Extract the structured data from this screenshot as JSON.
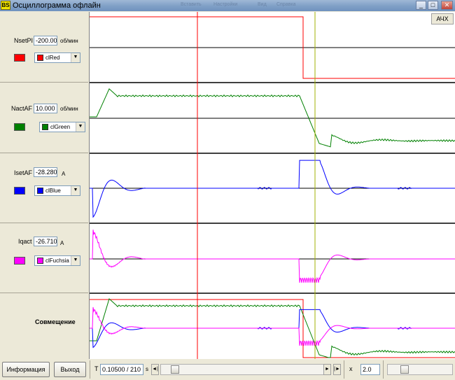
{
  "window": {
    "title": "Осциллограмма офлайн",
    "icon_text": "BS",
    "ghost_labels": [
      "Вставить",
      "Настройки",
      "Вид",
      "Справка"
    ],
    "buttons": [
      "_",
      "□",
      "✕"
    ]
  },
  "channels": [
    {
      "name": "NsetPI",
      "value": "-200.000",
      "unit": "об/мин",
      "color": "#ff0000",
      "color_name": "clRed"
    },
    {
      "name": "NactAF",
      "value": "10.000",
      "unit": "об/мин",
      "color": "#008000",
      "color_name": "clGreen"
    },
    {
      "name": "IsetAF",
      "value": "-28.280",
      "unit": "A",
      "color": "#0000ff",
      "color_name": "clBlue"
    },
    {
      "name": "Iqact",
      "value": "-26.710",
      "unit": "A",
      "color": "#ff00ff",
      "color_name": "clFuchsia"
    }
  ],
  "overlay": {
    "label": "Совмещение"
  },
  "plot": {
    "ach_button": "АЧХ",
    "cursor_colors": {
      "red": "#ff0000",
      "olive": "#a0b000"
    }
  },
  "bottom": {
    "info_button": "Информация",
    "exit_button": "Выход",
    "t_label": "T",
    "t_value": "0.10500 / 210",
    "t_unit": "s",
    "nav_left": "◄|",
    "nav_right": "|►",
    "x_label": "x",
    "x_value": "2.0"
  },
  "chart_data": {
    "type": "line",
    "cursor_red_fraction": 0.295,
    "cursor_olive_fraction": 0.615,
    "series": [
      {
        "name": "NsetPI",
        "levels": [
          -200,
          0
        ],
        "step_fraction": 0.58
      },
      {
        "name": "NactAF",
        "settle_value": 10.0
      },
      {
        "name": "IsetAF",
        "value": -28.28
      },
      {
        "name": "Iqact",
        "value": -26.71
      }
    ]
  }
}
